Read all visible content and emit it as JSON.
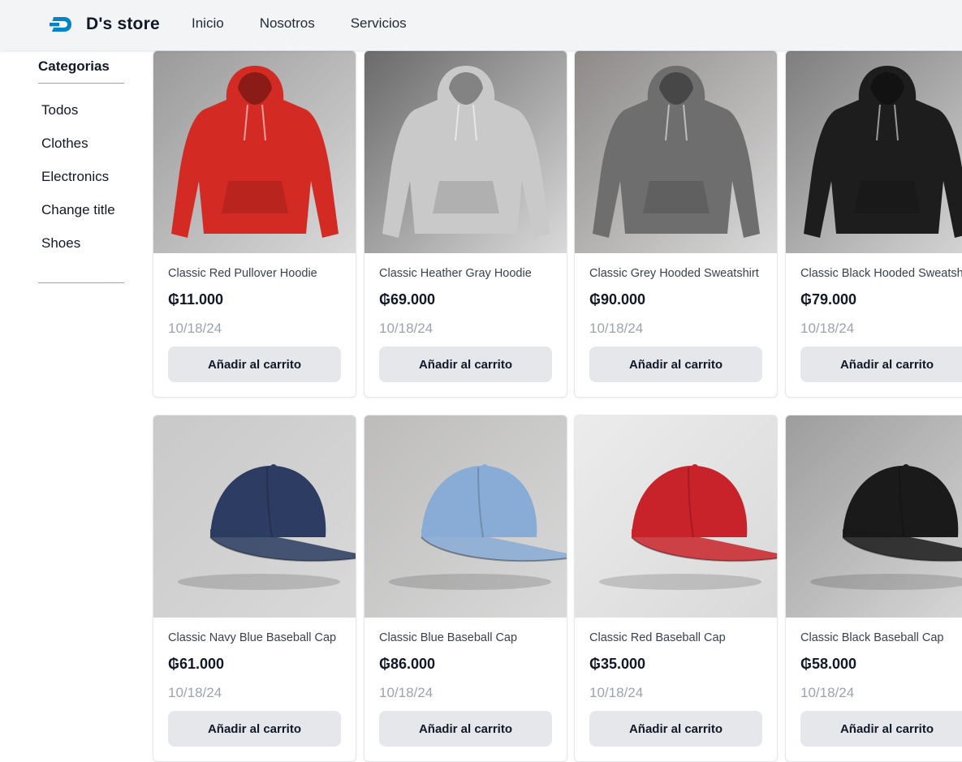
{
  "navbar": {
    "brand": "D's store",
    "links": [
      "Inicio",
      "Nosotros",
      "Servicios"
    ],
    "logo_color": "#0284c7"
  },
  "sidebar": {
    "title": "Categorias",
    "items": [
      "Todos",
      "Clothes",
      "Electronics",
      "Change title",
      "Shoes"
    ]
  },
  "products": [
    {
      "title": "Classic Red Pullover Hoodie",
      "price": "₲11.000",
      "date": "10/18/24",
      "button": "Añadir al carrito",
      "color": "#d42a24",
      "kind": "hoodie"
    },
    {
      "title": "Classic Heather Gray Hoodie",
      "price": "₲69.000",
      "date": "10/18/24",
      "button": "Añadir al carrito",
      "color": "#c9c9c9",
      "kind": "hoodie"
    },
    {
      "title": "Classic Grey Hooded Sweatshirt",
      "price": "₲90.000",
      "date": "10/18/24",
      "button": "Añadir al carrito",
      "color": "#6e6e6e",
      "kind": "hoodie"
    },
    {
      "title": "Classic Black Hooded Sweatshirt",
      "price": "₲79.000",
      "date": "10/18/24",
      "button": "Añadir al carrito",
      "color": "#1d1d1d",
      "kind": "hoodie"
    },
    {
      "title": "Classic Navy Blue Baseball Cap",
      "price": "₲61.000",
      "date": "10/18/24",
      "button": "Añadir al carrito",
      "color": "#2c3c62",
      "kind": "cap"
    },
    {
      "title": "Classic Blue Baseball Cap",
      "price": "₲86.000",
      "date": "10/18/24",
      "button": "Añadir al carrito",
      "color": "#88acd6",
      "kind": "cap"
    },
    {
      "title": "Classic Red Baseball Cap",
      "price": "₲35.000",
      "date": "10/18/24",
      "button": "Añadir al carrito",
      "color": "#c8232a",
      "kind": "cap"
    },
    {
      "title": "Classic Black Baseball Cap",
      "price": "₲58.000",
      "date": "10/18/24",
      "button": "Añadir al carrito",
      "color": "#1a1a1a",
      "kind": "cap"
    }
  ]
}
